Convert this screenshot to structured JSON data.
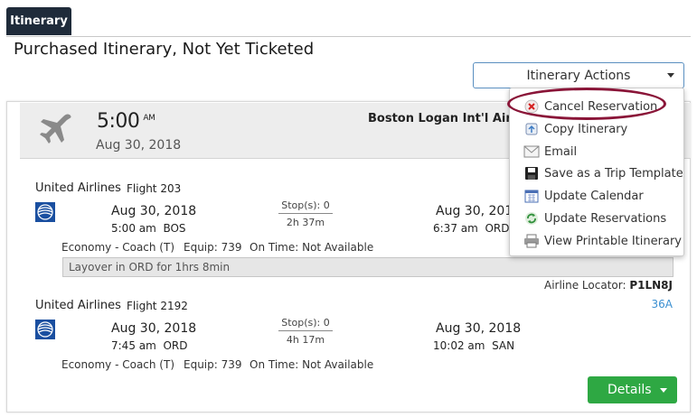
{
  "tab": {
    "label": "Itinerary"
  },
  "page_title": "Purchased Itinerary, Not Yet Ticketed",
  "actions": {
    "label": "Itinerary Actions"
  },
  "header": {
    "time": "5:00",
    "ampm": "AM",
    "date": "Aug 30, 2018",
    "airport": "Boston Logan Int'l Airport to"
  },
  "segments": [
    {
      "airline": "United Airlines",
      "flight": "Flight 203",
      "depart_date": "Aug 30, 2018",
      "depart_time": "5:00 am",
      "depart_code": "BOS",
      "stops": "Stop(s): 0",
      "duration": "2h 37m",
      "arrive_date": "Aug 30, 2018",
      "arrive_time": "6:37 am",
      "arrive_code": "ORD",
      "cabin": "Economy - Coach (T)",
      "equip": "Equip: 739",
      "on_time": "On Time: Not Available"
    },
    {
      "airline": "United Airlines",
      "flight": "Flight 2192",
      "depart_date": "Aug 30, 2018",
      "depart_time": "7:45 am",
      "depart_code": "ORD",
      "stops": "Stop(s): 0",
      "duration": "4h 17m",
      "arrive_date": "Aug 30, 2018",
      "arrive_time": "10:02 am",
      "arrive_code": "SAN",
      "cabin": "Economy - Coach (T)",
      "equip": "Equip: 739",
      "on_time": "On Time: Not Available"
    }
  ],
  "layover": "Layover in ORD for 1hrs 8min",
  "locator": {
    "label": "Airline Locator:",
    "value": "P1LN8J"
  },
  "seat": "36A",
  "details": {
    "label": "Details"
  },
  "menu": {
    "items": [
      {
        "label": "Cancel Reservation",
        "icon": "cancel-x-icon"
      },
      {
        "label": "Copy Itinerary",
        "icon": "copy-icon"
      },
      {
        "label": "Email",
        "icon": "envelope-icon"
      },
      {
        "label": "Save as a Trip Template",
        "icon": "floppy-disk-icon"
      },
      {
        "label": "Update Calendar",
        "icon": "calendar-icon"
      },
      {
        "label": "Update Reservations",
        "icon": "refresh-icon"
      },
      {
        "label": "View Printable Itinerary",
        "icon": "printer-icon"
      }
    ]
  },
  "colors": {
    "tab_bg": "#1f2b3a",
    "accent_blue": "#3a8fd1",
    "details_green": "#2ea843",
    "highlight_ring": "#8a1538",
    "united_blue": "#1a4fa0"
  }
}
